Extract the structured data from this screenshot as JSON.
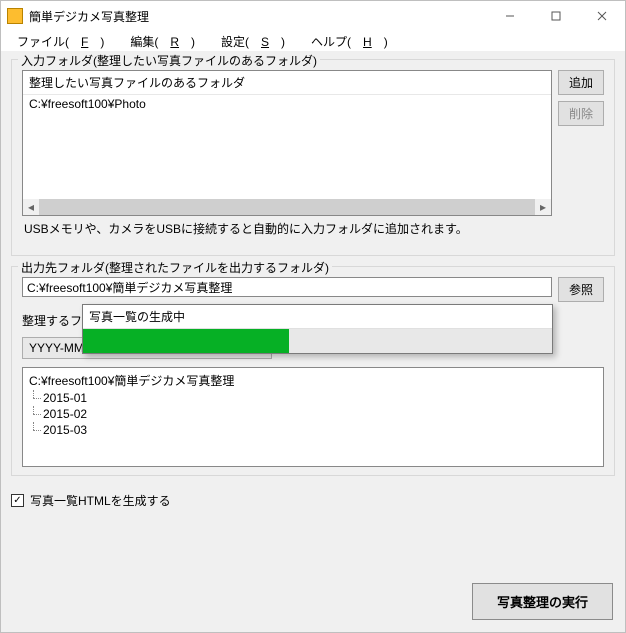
{
  "window": {
    "title": "簡単デジカメ写真整理"
  },
  "menu": {
    "file": "ファイル(",
    "file_k": "F",
    "file_end": ")",
    "edit": "編集(",
    "edit_k": "R",
    "edit_end": ")",
    "settings": "設定(",
    "settings_k": "S",
    "settings_end": ")",
    "help": "ヘルプ(",
    "help_k": "H",
    "help_end": ")"
  },
  "input_folder": {
    "legend": "入力フォルダ(整理したい写真ファイルのあるフォルダ)",
    "header": "整理したい写真ファイルのあるフォルダ",
    "items": [
      "C:¥freesoft100¥Photo"
    ],
    "add": "追加",
    "remove": "削除",
    "hint": "USBメモリや、カメラをUSBに接続すると自動的に入力フォルダに追加されます。"
  },
  "output_folder": {
    "legend": "出力先フォルダ(整理されたファイルを出力するフォルダ)",
    "path": "C:¥freesoft100¥簡単デジカメ写真整理",
    "browse": "参照",
    "format_label": "整理するフォーマット",
    "format_value": "YYYY-MM",
    "tree_root": "C:¥freesoft100¥簡単デジカメ写真整理",
    "tree_children": [
      "2015-01",
      "2015-02",
      "2015-03"
    ]
  },
  "checkbox": {
    "label": "写真一覧HTMLを生成する",
    "checked": true
  },
  "execute": "写真整理の実行",
  "progress": {
    "title": "写真一覧の生成中",
    "percent": 44
  }
}
